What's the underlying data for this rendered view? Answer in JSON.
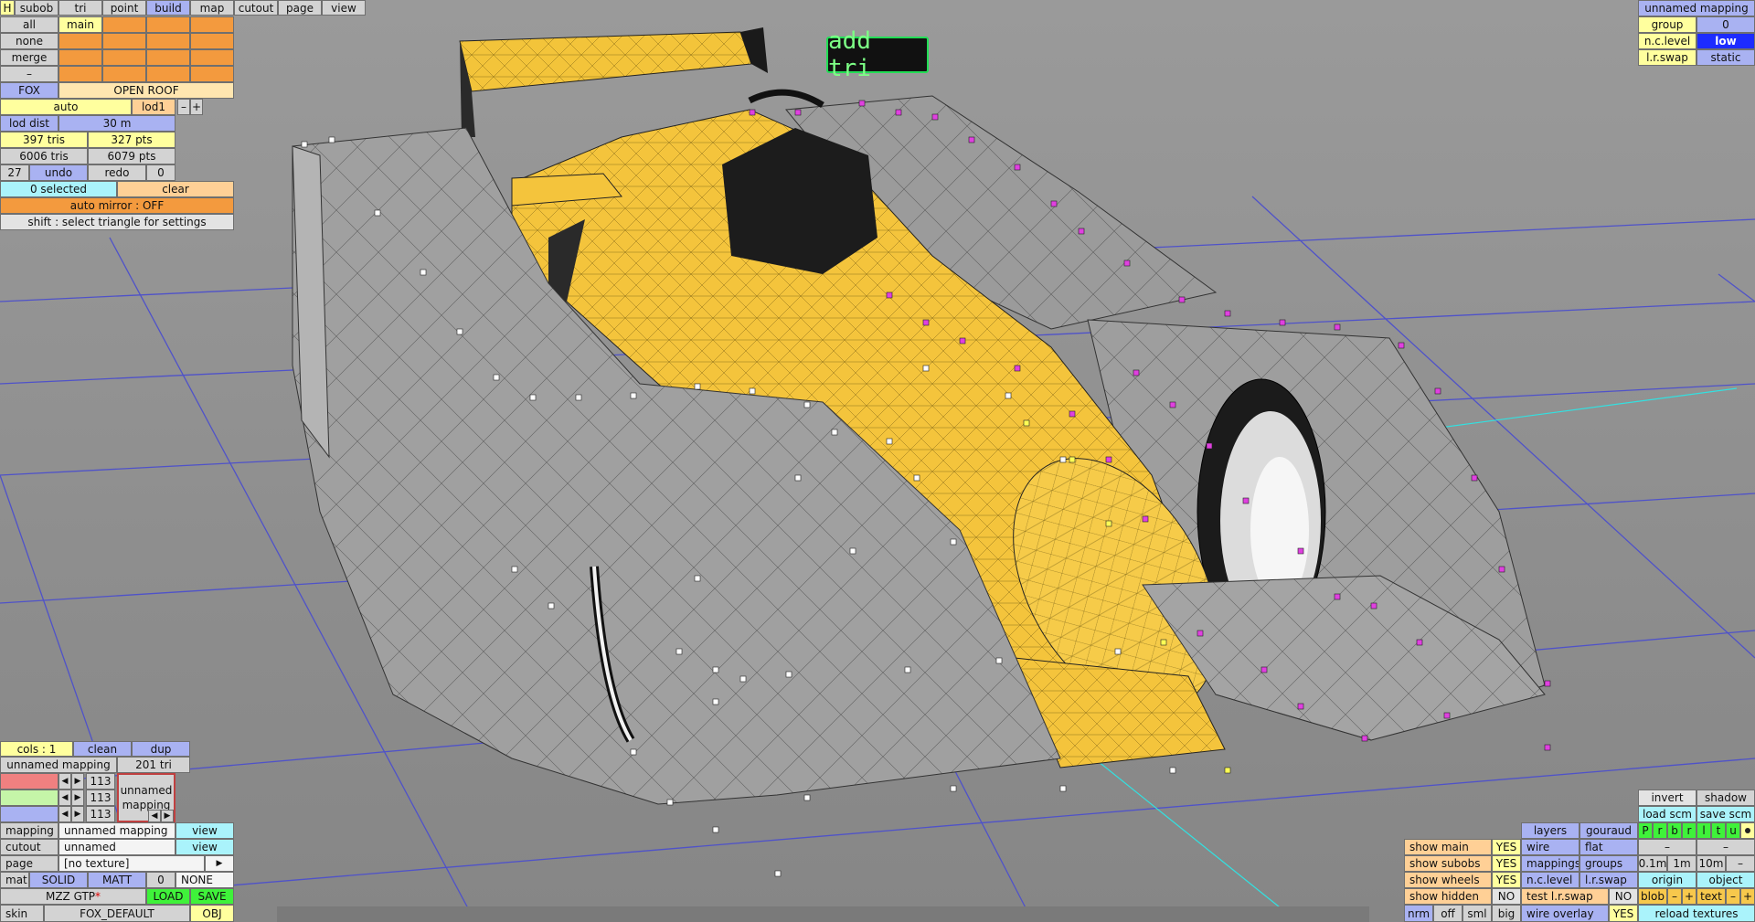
{
  "menu": {
    "h": "H",
    "tabs": [
      {
        "label": "subob"
      },
      {
        "label": "tri"
      },
      {
        "label": "point"
      },
      {
        "label": "build"
      },
      {
        "label": "map"
      },
      {
        "label": "cutout"
      },
      {
        "label": "page"
      },
      {
        "label": "view"
      }
    ]
  },
  "select_panel": {
    "all": "all",
    "main": "main",
    "none": "none",
    "merge": "merge",
    "dash": "–",
    "fox": "FOX",
    "open_roof": "OPEN ROOF",
    "auto": "auto",
    "lod": "lod1",
    "minus": "–",
    "plus": "+",
    "lod_dist_label": "lod dist",
    "lod_dist_value": "30 m",
    "tris": "397 tris",
    "pts": "327 pts",
    "total_tris": "6006 tris",
    "total_pts": "6079 pts",
    "undo_count": "27",
    "undo": "undo",
    "redo": "redo",
    "redo_count": "0",
    "selected": "0 selected",
    "clear": "clear",
    "auto_mirror": "auto mirror : OFF",
    "hint": "shift : select triangle for settings"
  },
  "mode_label": "add tri",
  "mapping_panel": {
    "unnamed_mapping": "unnamed mapping",
    "group_label": "group",
    "group_value": "0",
    "nc_level_label": "n.c.level",
    "nc_level_value": "low",
    "lr_swap_label": "l.r.swap",
    "lr_swap_value": "static"
  },
  "cols_panel": {
    "cols": "cols : 1",
    "clean": "clean",
    "dup": "dup",
    "mapping_name": "unnamed mapping",
    "tri_count": "201 tri",
    "arrow_left": "◀",
    "arrow_right": "▶",
    "rows": [
      {
        "value": "113"
      },
      {
        "value": "113"
      },
      {
        "value": "113"
      }
    ],
    "preview_line1": "unnamed",
    "preview_line2": "mapping"
  },
  "props_panel": {
    "mapping_label": "mapping",
    "mapping_value": "unnamed mapping",
    "mapping_view": "view",
    "cutout_label": "cutout",
    "cutout_value": "unnamed",
    "cutout_view": "view",
    "page_label": "page",
    "page_value": "[no texture]",
    "page_arrow": "▶",
    "mat_label": "mat",
    "solid": "SOLID",
    "matt": "MATT",
    "mat_num": "0",
    "none": "NONE",
    "car_name": "MZZ GTP",
    "star": "*",
    "load": "LOAD",
    "save": "SAVE",
    "skin_label": "skin",
    "skin_value": "FOX_DEFAULT",
    "obj": "OBJ"
  },
  "view_panel": {
    "invert": "invert",
    "shadow": "shadow",
    "load_scm": "load scm",
    "save_scm": "save scm",
    "layers": "layers",
    "gouraud": "gouraud",
    "layer_letters": [
      "P",
      "r",
      "b",
      "r",
      "l",
      "t",
      "u"
    ],
    "show_main": "show main",
    "show_main_v": "YES",
    "wire": "wire",
    "flat": "flat",
    "dash": "–",
    "show_subobs": "show subobs",
    "show_subobs_v": "YES",
    "mappings": "mappings",
    "groups": "groups",
    "d01": "0.1m",
    "d1": "1m",
    "d10": "10m",
    "show_wheels": "show wheels",
    "show_wheels_v": "YES",
    "nc_level": "n.c.level",
    "lr_swap": "l.r.swap",
    "origin": "origin",
    "object": "object",
    "show_hidden": "show hidden",
    "show_hidden_v": "NO",
    "test_lr_swap": "test l.r.swap",
    "test_lr_swap_v": "NO",
    "blob": "blob",
    "text": "text",
    "minus": "–",
    "plus": "+",
    "nrm": "nrm",
    "off": "off",
    "sml": "sml",
    "big": "big",
    "wire_overlay": "wire overlay",
    "wire_overlay_v": "YES",
    "reload_textures": "reload textures"
  }
}
